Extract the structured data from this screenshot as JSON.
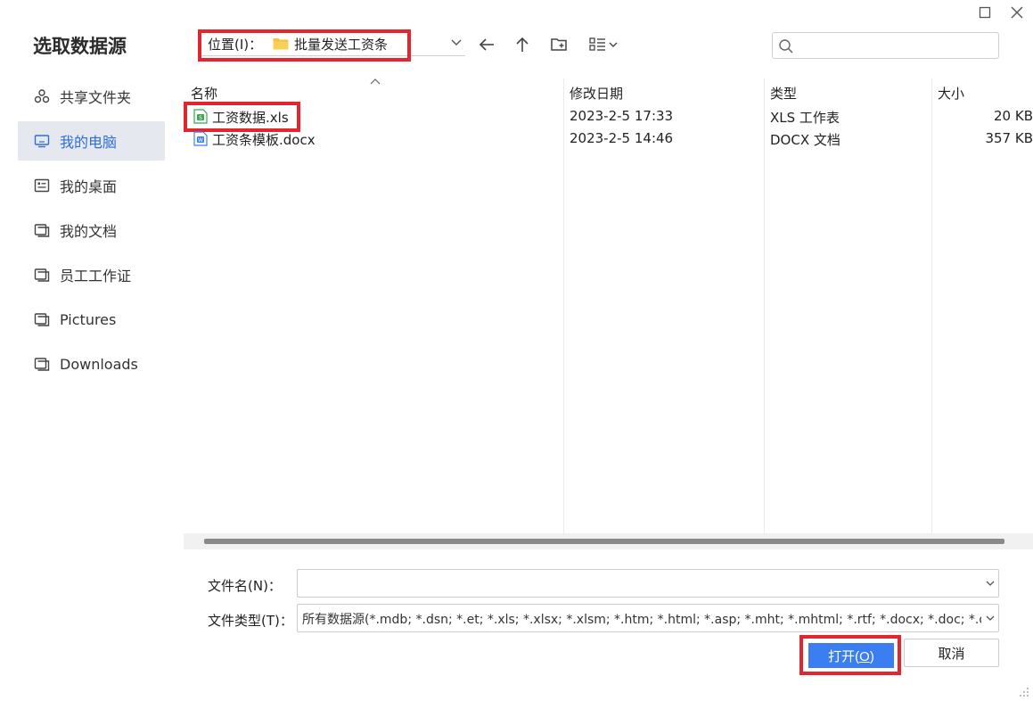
{
  "dialog": {
    "title": "选取数据源"
  },
  "sidebar": {
    "items": [
      {
        "label": "共享文件夹",
        "icon": "share-icon",
        "active": false
      },
      {
        "label": "我的电脑",
        "icon": "computer-icon",
        "active": true
      },
      {
        "label": "我的桌面",
        "icon": "desktop-icon",
        "active": false
      },
      {
        "label": "我的文档",
        "icon": "folder-icon",
        "active": false
      },
      {
        "label": "员工工作证",
        "icon": "folder-icon",
        "active": false
      },
      {
        "label": "Pictures",
        "icon": "folder-icon",
        "active": false
      },
      {
        "label": "Downloads",
        "icon": "folder-icon",
        "active": false
      }
    ]
  },
  "toolbar": {
    "location_label": "位置(I)：",
    "location_value": "批量发送工资条",
    "search_placeholder": ""
  },
  "file_list": {
    "columns": [
      "名称",
      "修改日期",
      "类型",
      "大小"
    ],
    "rows": [
      {
        "name": "工资数据.xls",
        "modified": "2023-2-5 17:33",
        "type": "XLS 工作表",
        "size": "20 KB",
        "icon": "xls-file-icon"
      },
      {
        "name": "工资条模板.docx",
        "modified": "2023-2-5 14:46",
        "type": "DOCX 文档",
        "size": "357 KB",
        "icon": "docx-file-icon"
      }
    ]
  },
  "footer": {
    "filename_label": "文件名(N)：",
    "filename_value": "",
    "filetype_label": "文件类型(T)：",
    "filetype_value": "所有数据源(*.mdb; *.dsn; *.et; *.xls; *.xlsx; *.xlsm; *.htm; *.html; *.asp; *.mht; *.mhtml; *.rtf; *.docx; *.doc; *.docm; *",
    "open_label": "打开(",
    "open_mnemonic": "O",
    "open_label_end": ")",
    "cancel_label": "取消"
  },
  "colors": {
    "accent": "#3b7ef2",
    "highlight_box": "#e3262d",
    "active_sidebar_bg": "#e5e8ef",
    "active_sidebar_text": "#2f6fd6"
  }
}
